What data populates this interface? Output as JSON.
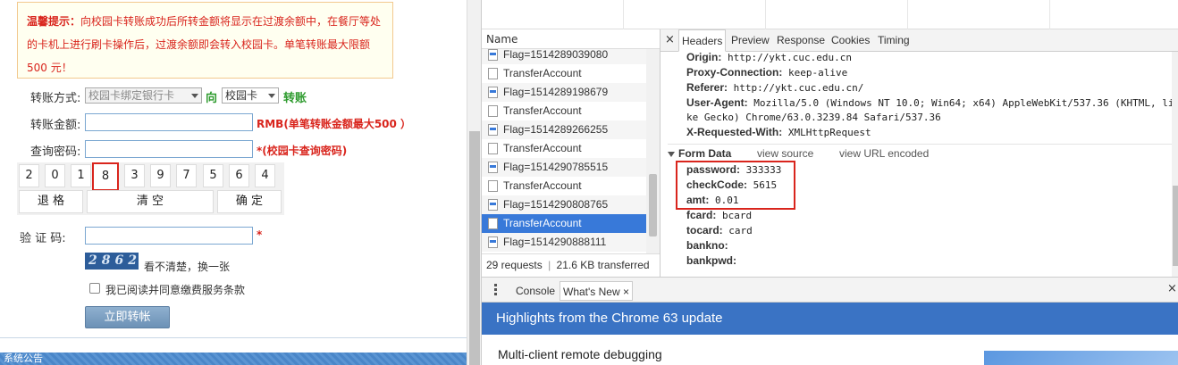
{
  "transfer": {
    "notice_title": "温馨提示：",
    "notice_text": "向校园卡转账成功后所转金额将显示在过渡余额中，在餐厅等处的卡机上进行刷卡操作后，过渡余额即会转入校园卡。单笔转账最大限额 500 元！",
    "type_label": "转账方式:",
    "type_from": "校园卡绑定银行卡",
    "direction": "向",
    "type_to": "校园卡",
    "type_suffix": "转账",
    "amount_label": "转账金额:",
    "amount_value": "",
    "amount_note": "RMB(单笔转账金额最大500 ）",
    "password_label": "查询密码:",
    "password_value": "",
    "password_note": "*(校园卡查询密码)",
    "keys": [
      "2",
      "0",
      "1",
      "8",
      "3",
      "9",
      "7",
      "5",
      "6",
      "4"
    ],
    "key_backspace": "退 格",
    "key_clear": "清    空",
    "key_confirm": "确 定",
    "captcha_label": "验 证 码:",
    "captcha_value": "",
    "captcha_star": "*",
    "captcha_image_text": "2862",
    "captcha_refresh": "看不清楚，换一张",
    "agree_text": "我已阅读并同意缴费服务条款",
    "submit_label": "立即转帐",
    "bottom_text": "系统公告"
  },
  "devtools": {
    "name_header": "Name",
    "requests": [
      {
        "name": "Flag=1514289039080",
        "type": "xhr"
      },
      {
        "name": "TransferAccount",
        "type": "doc"
      },
      {
        "name": "Flag=1514289198679",
        "type": "xhr"
      },
      {
        "name": "TransferAccount",
        "type": "doc"
      },
      {
        "name": "Flag=1514289266255",
        "type": "xhr"
      },
      {
        "name": "TransferAccount",
        "type": "doc"
      },
      {
        "name": "Flag=1514290785515",
        "type": "xhr"
      },
      {
        "name": "TransferAccount",
        "type": "doc"
      },
      {
        "name": "Flag=1514290808765",
        "type": "xhr"
      },
      {
        "name": "TransferAccount",
        "type": "doc",
        "selected": true
      },
      {
        "name": "Flag=1514290888111",
        "type": "xhr"
      }
    ],
    "summary_requests": "29 requests",
    "summary_sep": "|",
    "summary_transferred": "21.6 KB transferred",
    "tabs": [
      "Headers",
      "Preview",
      "Response",
      "Cookies",
      "Timing"
    ],
    "active_tab": "Headers",
    "close_symbol": "×",
    "request_headers": [
      {
        "key": "Origin:",
        "value": "http://ykt.cuc.edu.cn"
      },
      {
        "key": "Proxy-Connection:",
        "value": "keep-alive"
      },
      {
        "key": "Referer:",
        "value": "http://ykt.cuc.edu.cn/"
      },
      {
        "key": "User-Agent:",
        "value": "Mozilla/5.0 (Windows NT 10.0; Win64; x64) AppleWebKit/537.36 (KHTML, li"
      },
      {
        "key": "",
        "value": "ke Gecko) Chrome/63.0.3239.84 Safari/537.36"
      },
      {
        "key": "X-Requested-With:",
        "value": "XMLHttpRequest"
      }
    ],
    "form_data_title": "Form Data",
    "view_source": "view source",
    "view_url_encoded": "view URL encoded",
    "form_data": [
      {
        "key": "password:",
        "value": "333333"
      },
      {
        "key": "checkCode:",
        "value": "5615"
      },
      {
        "key": "amt:",
        "value": "0.01"
      },
      {
        "key": "fcard:",
        "value": "bcard"
      },
      {
        "key": "tocard:",
        "value": "card"
      },
      {
        "key": "bankno:",
        "value": ""
      },
      {
        "key": "bankpwd:",
        "value": ""
      }
    ],
    "drawer_tabs": [
      "Console",
      "What's New"
    ],
    "drawer_active": "What's New",
    "whats_new_title": "Highlights from the Chrome 63 update",
    "whats_new_item": "Multi-client remote debugging"
  }
}
